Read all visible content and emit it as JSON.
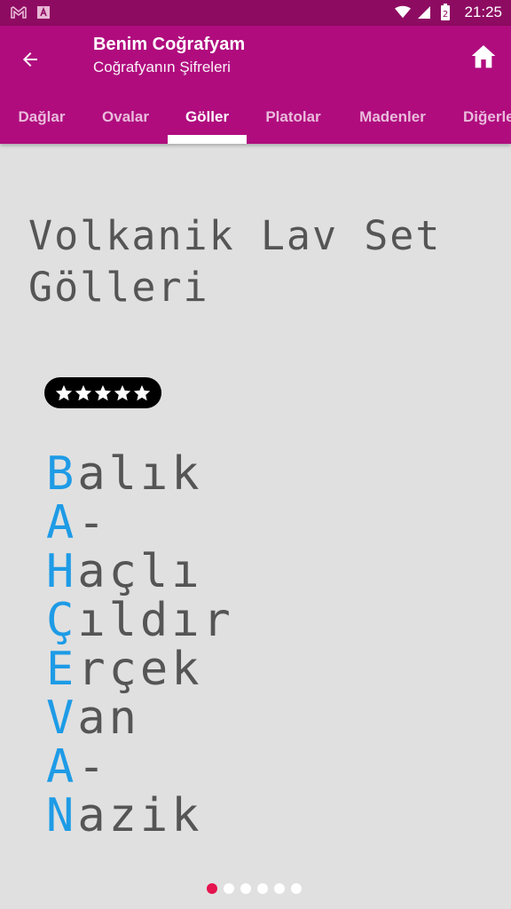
{
  "status_bar": {
    "time": "21:25",
    "icons": [
      "gmail-icon",
      "notification-a-icon",
      "wifi-icon",
      "signal-icon",
      "battery-icon"
    ],
    "battery_text": "2"
  },
  "app_bar": {
    "title": "Benim Coğrafyam",
    "subtitle": "Coğrafyanın Şifreleri",
    "back_icon": "arrow-back-icon",
    "home_icon": "home-icon",
    "color": "#b00c7e"
  },
  "tabs": [
    {
      "label": "Dağlar",
      "active": false
    },
    {
      "label": "Ovalar",
      "active": false
    },
    {
      "label": "Göller",
      "active": true
    },
    {
      "label": "Platolar",
      "active": false
    },
    {
      "label": "Madenler",
      "active": false
    },
    {
      "label": "Diğerleri",
      "active": false
    }
  ],
  "content": {
    "heading": "Volkanik Lav Set Gölleri",
    "rating": 5,
    "rating_max": 5,
    "acrostic": [
      {
        "first": "B",
        "rest": "alık"
      },
      {
        "first": "A",
        "rest": "-"
      },
      {
        "first": "H",
        "rest": "açlı"
      },
      {
        "first": "Ç",
        "rest": "ıldır"
      },
      {
        "first": "E",
        "rest": "rçek"
      },
      {
        "first": "V",
        "rest": "an"
      },
      {
        "first": "A",
        "rest": "-"
      },
      {
        "first": "N",
        "rest": "azik"
      }
    ],
    "accent_color": "#1e9be6"
  },
  "pager": {
    "count": 6,
    "active_index": 0,
    "active_color": "#e5134e"
  }
}
